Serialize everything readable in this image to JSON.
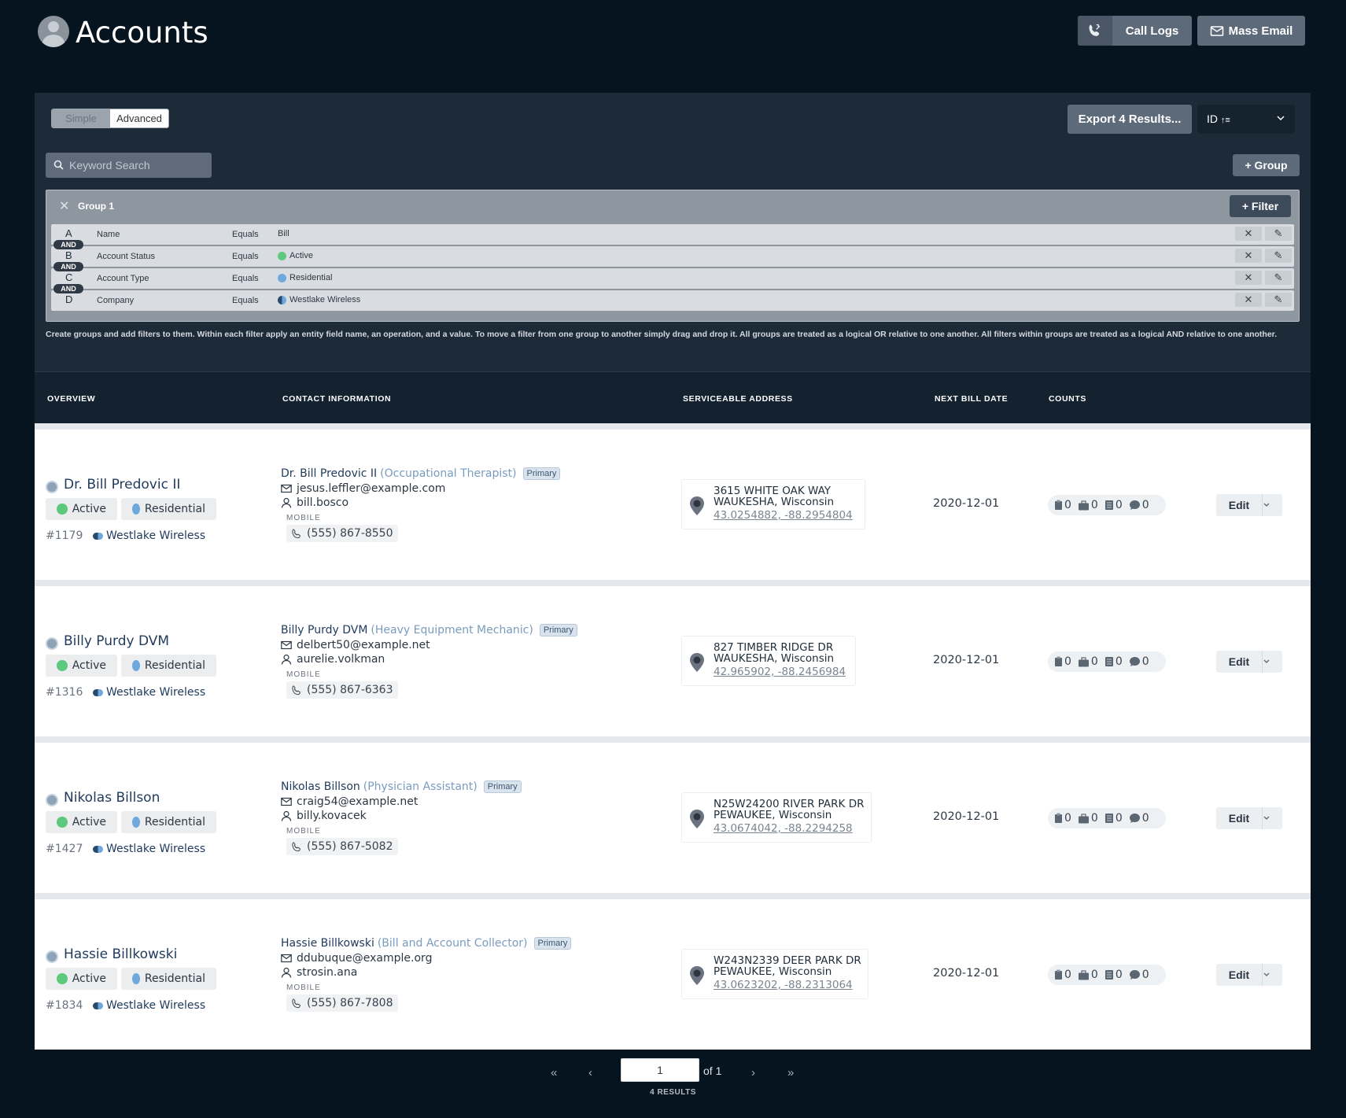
{
  "header": {
    "title": "Accounts",
    "call_logs_label": "Call Logs",
    "mass_email_label": "Mass Email"
  },
  "filters": {
    "mode_simple": "Simple",
    "mode_advanced": "Advanced",
    "mode_selected": "Advanced",
    "export_label": "Export 4 Results...",
    "sort_value": "ID",
    "search_placeholder": "Keyword Search",
    "add_group_label": "+ Group",
    "group_title": "Group 1",
    "add_filter_label": "+ Filter",
    "conjunction": "AND",
    "rows": [
      {
        "letter": "A",
        "field": "Name",
        "operator": "Equals",
        "value": "Bill",
        "value_dot": ""
      },
      {
        "letter": "B",
        "field": "Account Status",
        "operator": "Equals",
        "value": "Active",
        "value_dot": "green"
      },
      {
        "letter": "C",
        "field": "Account Type",
        "operator": "Equals",
        "value": "Residential",
        "value_dot": "blue"
      },
      {
        "letter": "D",
        "field": "Company",
        "operator": "Equals",
        "value": "Westlake Wireless",
        "value_dot": "half"
      }
    ],
    "help_text": "Create groups and add filters to them. Within each filter apply an entity field name, an operation, and a value. To move a filter from one group to another simply drag and drop it. All groups are treated as a logical OR relative to one another. All filters within groups are treated as a logical AND relative to one another."
  },
  "table": {
    "columns": [
      "OVERVIEW",
      "CONTACT INFORMATION",
      "SERVICEABLE ADDRESS",
      "NEXT BILL DATE",
      "COUNTS"
    ],
    "edit_label": "Edit",
    "mobile_label": "MOBILE",
    "primary_label": "Primary",
    "rows": [
      {
        "name": "Dr. Bill Predovic II",
        "status": "Active",
        "type": "Residential",
        "id": "#1179",
        "company": "Westlake Wireless",
        "contact_name": "Dr. Bill Predovic II",
        "contact_role": "(Occupational Therapist)",
        "email": "jesus.leffler@example.com",
        "username": "bill.bosco",
        "phone": "(555) 867-8550",
        "address_line1": "3615 WHITE OAK WAY",
        "address_line2": "WAUKESHA, Wisconsin",
        "coords": "43.0254882, -88.2954804",
        "next_bill_date": "2020-12-01",
        "counts": [
          "0",
          "0",
          "0",
          "0"
        ]
      },
      {
        "name": "Billy Purdy DVM",
        "status": "Active",
        "type": "Residential",
        "id": "#1316",
        "company": "Westlake Wireless",
        "contact_name": "Billy Purdy DVM",
        "contact_role": "(Heavy Equipment Mechanic)",
        "email": "delbert50@example.net",
        "username": "aurelie.volkman",
        "phone": "(555) 867-6363",
        "address_line1": "827 TIMBER RIDGE DR",
        "address_line2": "WAUKESHA, Wisconsin",
        "coords": "42.965902, -88.2456984",
        "next_bill_date": "2020-12-01",
        "counts": [
          "0",
          "0",
          "0",
          "0"
        ]
      },
      {
        "name": "Nikolas Billson",
        "status": "Active",
        "type": "Residential",
        "id": "#1427",
        "company": "Westlake Wireless",
        "contact_name": "Nikolas Billson",
        "contact_role": "(Physician Assistant)",
        "email": "craig54@example.net",
        "username": "billy.kovacek",
        "phone": "(555) 867-5082",
        "address_line1": "N25W24200 RIVER PARK DR",
        "address_line2": "PEWAUKEE, Wisconsin",
        "coords": "43.0674042, -88.2294258",
        "next_bill_date": "2020-12-01",
        "counts": [
          "0",
          "0",
          "0",
          "0"
        ]
      },
      {
        "name": "Hassie Billkowski",
        "status": "Active",
        "type": "Residential",
        "id": "#1834",
        "company": "Westlake Wireless",
        "contact_name": "Hassie Billkowski",
        "contact_role": "(Bill and Account Collector)",
        "email": "ddubuque@example.org",
        "username": "strosin.ana",
        "phone": "(555) 867-7808",
        "address_line1": "W243N2339 DEER PARK DR",
        "address_line2": "PEWAUKEE, Wisconsin",
        "coords": "43.0623202, -88.2313064",
        "next_bill_date": "2020-12-01",
        "counts": [
          "0",
          "0",
          "0",
          "0"
        ]
      }
    ]
  },
  "pagination": {
    "first": "«",
    "prev": "‹",
    "next": "›",
    "last": "»",
    "current_page": "1",
    "of_label": "of 1",
    "results_label": "4 RESULTS"
  },
  "colors": {
    "background": "#05141f",
    "panel": "#1d2b38",
    "status_active": "#5ec97d",
    "type_residential": "#6fa8dc"
  }
}
